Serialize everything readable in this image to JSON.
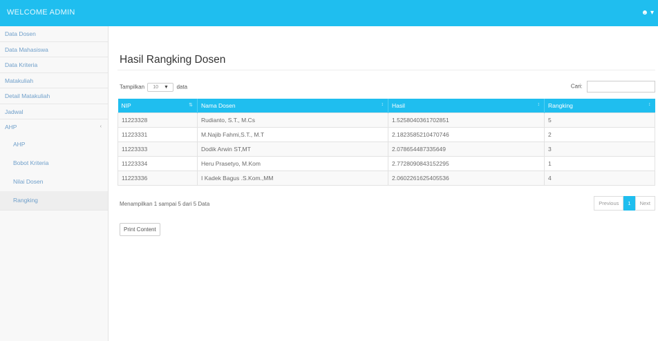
{
  "topbar": {
    "brand": "WELCOME ADMIN",
    "user_icon": "user-icon"
  },
  "sidebar": {
    "items": [
      {
        "label": "Data Dosen"
      },
      {
        "label": "Data Mahasiswa"
      },
      {
        "label": "Data Kriteria"
      },
      {
        "label": "Matakuliah"
      },
      {
        "label": "Detail Matakuliah"
      },
      {
        "label": "Jadwal"
      }
    ],
    "group": {
      "label": "AHP",
      "caret": "‹"
    },
    "subitems": [
      {
        "label": "AHP"
      },
      {
        "label": "Bobot Kriteria"
      },
      {
        "label": "Nilai Dosen"
      },
      {
        "label": "Rangking"
      }
    ]
  },
  "main": {
    "title": "Hasil Rangking Dosen",
    "length": {
      "prefix": "Tampilkan",
      "value": "10",
      "suffix": "data"
    },
    "search_label": "Cari:",
    "columns": [
      "NIP",
      "Nama Dosen",
      "Hasil",
      "Rangking"
    ],
    "rows": [
      [
        "11223328",
        "Rudianto, S.T., M.Cs",
        "1.5258040361702851",
        "5"
      ],
      [
        "11223331",
        "M.Najib Fahmi,S.T., M.T",
        "2.1823585210470746",
        "2"
      ],
      [
        "11223333",
        "Dodik Arwin ST,MT",
        "2.078654487335649",
        "3"
      ],
      [
        "11223334",
        "Heru Prasetyo, M.Kom",
        "2.7728090843152295",
        "1"
      ],
      [
        "11223336",
        "I Kadek Bagus .S.Kom.,MM",
        "2.0602261625405536",
        "4"
      ]
    ],
    "info": "Menampilkan 1 sampai 5 dari 5 Data",
    "pager": {
      "previous": "Previous",
      "current": "1",
      "next": "Next"
    },
    "print": "Print Content"
  },
  "colors": {
    "accent": "#1fbeef",
    "link": "#6f9fca"
  }
}
